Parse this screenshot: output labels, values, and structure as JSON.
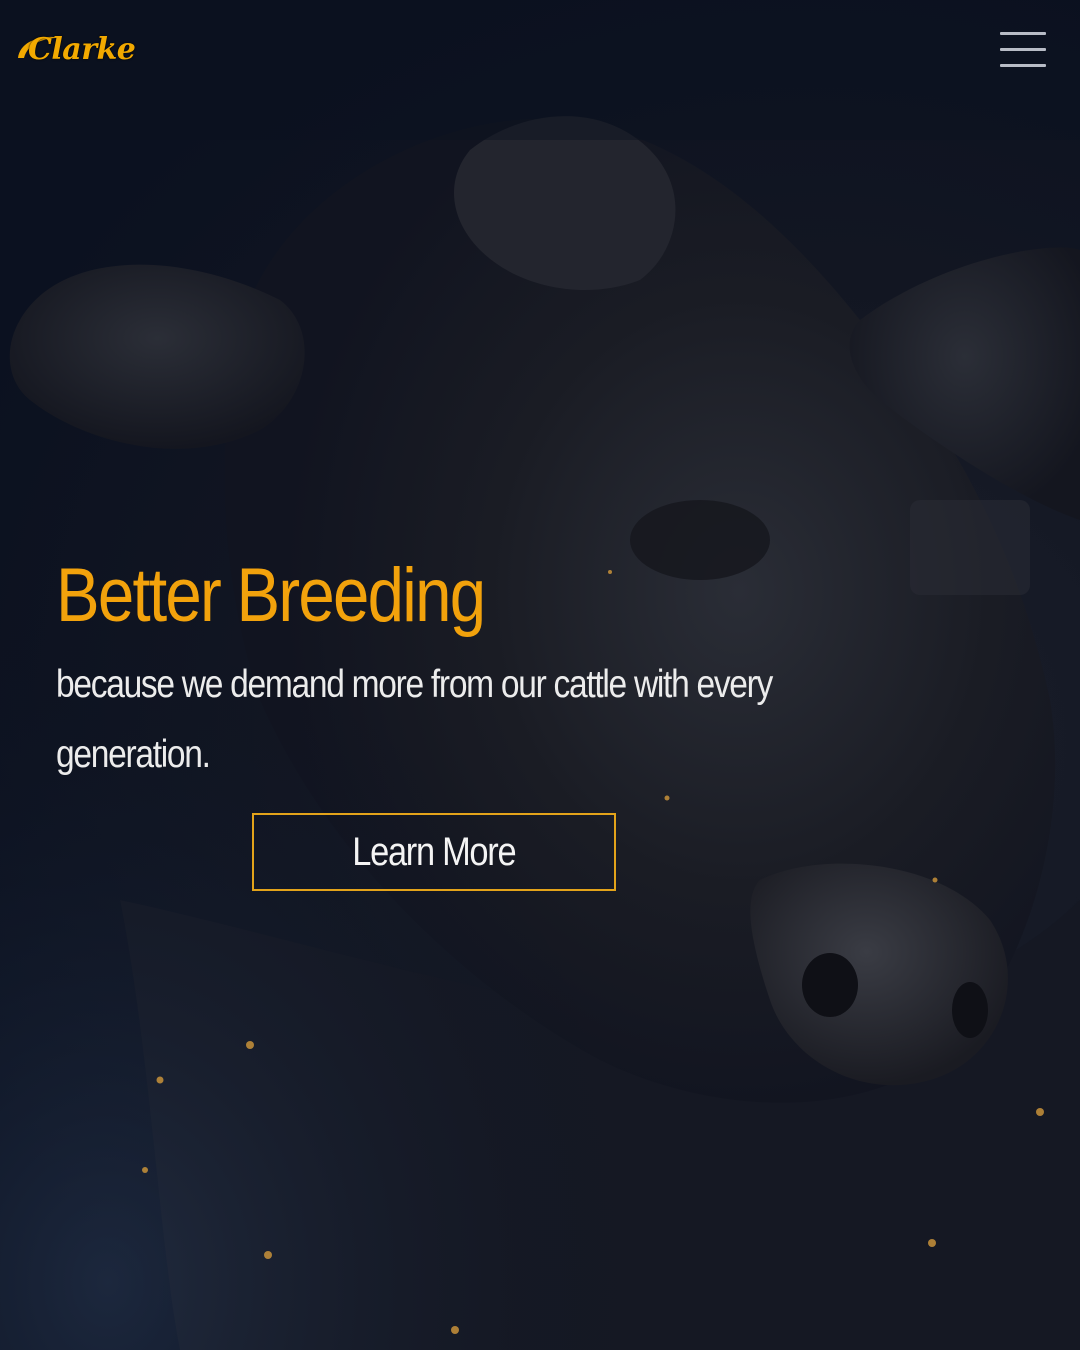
{
  "header": {
    "logo_text": "Clarke",
    "menu_icon": "hamburger-menu-icon"
  },
  "hero": {
    "image": "black-angus-cow-closeup",
    "title": "Better Breeding",
    "subtitle": "because we demand more from our cattle with every generation.",
    "cta_label": "Learn More"
  },
  "colors": {
    "accent": "#f2a20c",
    "background": "#0b1220",
    "text": "#ececec"
  }
}
